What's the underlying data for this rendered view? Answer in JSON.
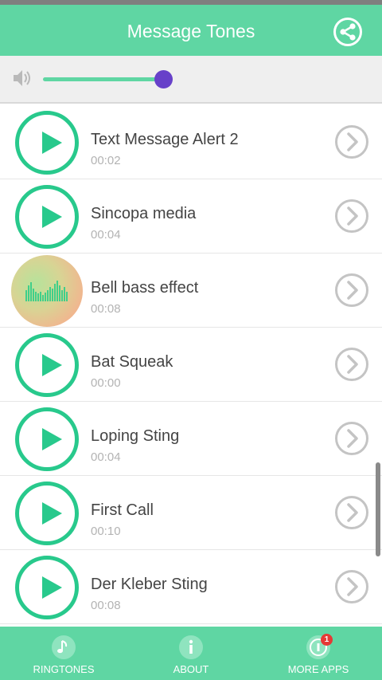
{
  "header": {
    "title": "Message Tones",
    "share_icon": "share-icon"
  },
  "volume": {
    "icon": "speaker-icon",
    "level": 0.93
  },
  "tones": [
    {
      "title": "Text Message Alert 2",
      "duration": "00:02",
      "state": "idle"
    },
    {
      "title": "Sincopa media",
      "duration": "00:04",
      "state": "idle"
    },
    {
      "title": "Bell bass effect",
      "duration": "00:08",
      "state": "playing"
    },
    {
      "title": "Bat Squeak",
      "duration": "00:00",
      "state": "idle"
    },
    {
      "title": "Loping Sting",
      "duration": "00:04",
      "state": "idle"
    },
    {
      "title": "First Call",
      "duration": "00:10",
      "state": "idle"
    },
    {
      "title": "Der Kleber Sting",
      "duration": "00:08",
      "state": "idle"
    }
  ],
  "bottom_nav": {
    "ringtones": {
      "label": "RINGTONES",
      "icon": "music-note-icon"
    },
    "about": {
      "label": "ABOUT",
      "icon": "info-icon"
    },
    "more_apps": {
      "label": "MORE APPS",
      "icon": "apps-icon",
      "badge": "1"
    }
  },
  "colors": {
    "accent": "#5fd6a3",
    "play": "#28c98c",
    "thumb": "#6741c9",
    "badge": "#e53935"
  }
}
